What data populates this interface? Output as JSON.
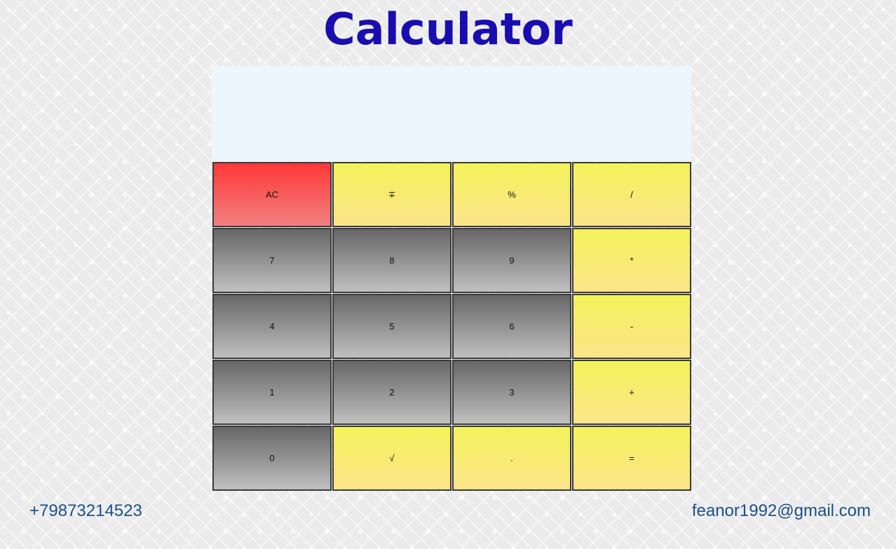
{
  "header": {
    "title": "Calculator"
  },
  "display": {
    "value": ""
  },
  "keys": [
    {
      "label": "AC",
      "kind": "clear",
      "name": "ac-button"
    },
    {
      "label": "∓",
      "kind": "op",
      "name": "sign-toggle-button"
    },
    {
      "label": "%",
      "kind": "op",
      "name": "percent-button"
    },
    {
      "label": "/",
      "kind": "op",
      "name": "divide-button"
    },
    {
      "label": "7",
      "kind": "num",
      "name": "digit-7-button"
    },
    {
      "label": "8",
      "kind": "num",
      "name": "digit-8-button"
    },
    {
      "label": "9",
      "kind": "num",
      "name": "digit-9-button"
    },
    {
      "label": "*",
      "kind": "op",
      "name": "multiply-button"
    },
    {
      "label": "4",
      "kind": "num",
      "name": "digit-4-button"
    },
    {
      "label": "5",
      "kind": "num",
      "name": "digit-5-button"
    },
    {
      "label": "6",
      "kind": "num",
      "name": "digit-6-button"
    },
    {
      "label": "-",
      "kind": "op",
      "name": "subtract-button"
    },
    {
      "label": "1",
      "kind": "num",
      "name": "digit-1-button"
    },
    {
      "label": "2",
      "kind": "num",
      "name": "digit-2-button"
    },
    {
      "label": "3",
      "kind": "num",
      "name": "digit-3-button"
    },
    {
      "label": "+",
      "kind": "op",
      "name": "add-button"
    },
    {
      "label": "0",
      "kind": "num",
      "name": "digit-0-button"
    },
    {
      "label": "√",
      "kind": "op",
      "name": "sqrt-button"
    },
    {
      "label": ".",
      "kind": "op",
      "name": "decimal-button"
    },
    {
      "label": "=",
      "kind": "op",
      "name": "equals-button"
    }
  ],
  "footer": {
    "phone": "+79873214523",
    "email": "feanor1992@gmail.com"
  },
  "colors": {
    "title": "#1a0db0",
    "display_bg": "#eef6fd",
    "clear_key": "#ff3838",
    "operator_key": "#f3f25a",
    "number_key": "#666666",
    "contact_text": "#1c4f8c"
  }
}
